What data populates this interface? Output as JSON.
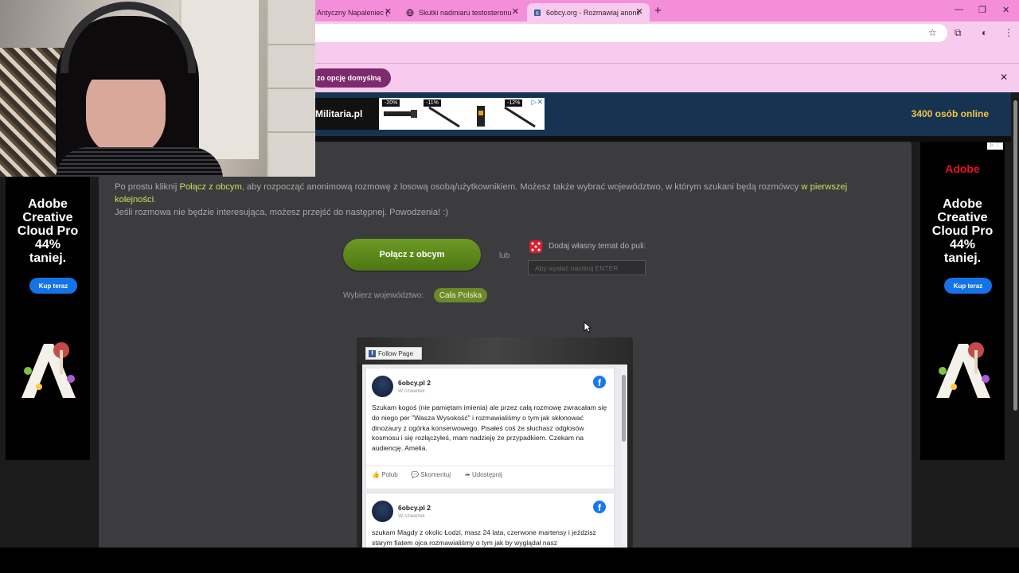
{
  "browser": {
    "tabs": [
      {
        "title": "Antyczny Napaleniec (",
        "active": false
      },
      {
        "title": "Skutki nadmiaru testosteronu",
        "active": false
      },
      {
        "title": "6obcy.org - Rozmawiaj anonim",
        "active": true
      }
    ],
    "new_tab_icon": "plus-icon",
    "window_controls": [
      "minimize-icon",
      "maximize-icon",
      "close-icon"
    ],
    "infobar_button": "zo opcję domyślną",
    "accent": "#f48ed9"
  },
  "header": {
    "banner_ad": {
      "brand": "Militaria.pl",
      "discounts": [
        "-20%",
        "-11%",
        "-12%"
      ]
    },
    "online_count": "3400 osób online"
  },
  "intro": {
    "p1_a": "Po prostu kliknij ",
    "p1_link": "Połącz z obcym",
    "p1_b": ", aby rozpocząć anonimową rozmowę z losową osobą/użytkownikiem. Możesz także wybrać województwo, w którym szukani będą rozmówcy ",
    "p1_link2": "w pierwszej kolejności",
    "p1_c": ".",
    "p2": "Jeśli rozmowa nie będzie interesująca, możesz przejść do następnej. Powodzenia! :)"
  },
  "controls": {
    "connect_button": "Połącz z obcym",
    "or": "lub",
    "topic_label": "Dodaj własny temat do puli:",
    "topic_placeholder": "Aby wysłać naciśnij ENTER",
    "region_label": "Wybierz województwo:",
    "region_value": "Cała Polska"
  },
  "side_ads": {
    "brand": "Adobe",
    "text_lines": [
      "Adobe",
      "Creative",
      "Cloud Pro",
      "44%",
      "taniej."
    ],
    "button": "Kup teraz"
  },
  "fb_widget": {
    "follow_label": "Follow Page",
    "posts": [
      {
        "page_name": "6obcy.pl 2",
        "time": "W czwartek",
        "text": "Szukam kogoś (nie pamiętam imienia) ale przez całą rozmowę zwracałam się do niego per \"Wasza Wysokość\" i rozmawialiśmy o tym jak skłonować dinozaury z ogórka konserwowego. Pisałeś coś że słuchasz odgłosów kosmosu i się rozłączyłeś, mam nadzieję że przypadkiem. Czekam na audiencję. Amelia.",
        "actions": [
          "Polub",
          "Skomentuj",
          "Udostępnij"
        ]
      },
      {
        "page_name": "6obcy.pl 2",
        "time": "W czwartek",
        "text": "szukam Magdy z okolic Łodzi, masz 24 lata, czerwone martensy i jeździsz starym fiatem ojca rozmawialiśmy o tym jak by wyglądał nasz"
      }
    ]
  }
}
